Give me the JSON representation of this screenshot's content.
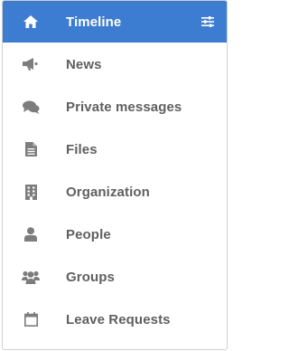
{
  "colors": {
    "accent": "#3d7dd1",
    "icon": "#7d7d7d",
    "text": "#5f5f5f"
  },
  "nav": {
    "items": [
      {
        "label": "Timeline",
        "icon": "home-icon",
        "active": true
      },
      {
        "label": "News",
        "icon": "megaphone-icon"
      },
      {
        "label": "Private messages",
        "icon": "chat-bubbles-icon"
      },
      {
        "label": "Files",
        "icon": "file-icon"
      },
      {
        "label": "Organization",
        "icon": "building-icon"
      },
      {
        "label": "People",
        "icon": "person-icon"
      },
      {
        "label": "Groups",
        "icon": "group-icon"
      },
      {
        "label": "Leave Requests",
        "icon": "calendar-icon"
      }
    ],
    "settings_icon": "sliders-icon"
  }
}
